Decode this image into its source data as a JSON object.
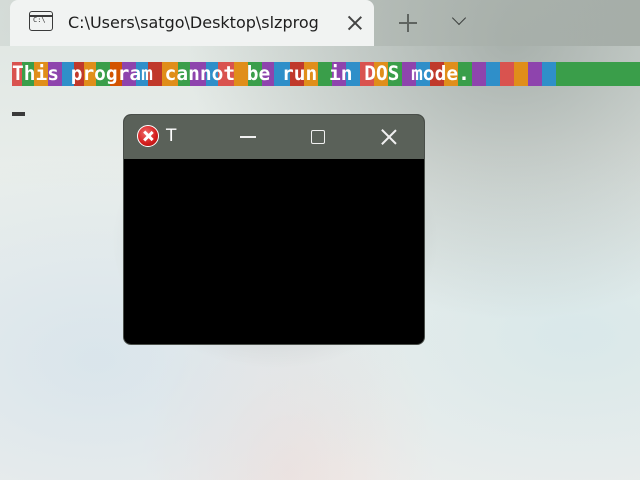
{
  "terminal": {
    "tab_title": "C:\\Users\\satgo\\Desktop\\slzprog",
    "tab_icon_text": "C:\\",
    "tab_icon": "terminal-icon",
    "close_tab_icon": "close-icon",
    "new_tab_icon": "plus-icon",
    "dropdown_icon": "chevron-down-icon",
    "output_line": "This program cannot be run in DOS mode."
  },
  "dialog": {
    "title": "T",
    "icon": "error-icon",
    "minimize_icon": "minimize-icon",
    "maximize_icon": "maximize-icon",
    "close_icon": "close-icon"
  }
}
